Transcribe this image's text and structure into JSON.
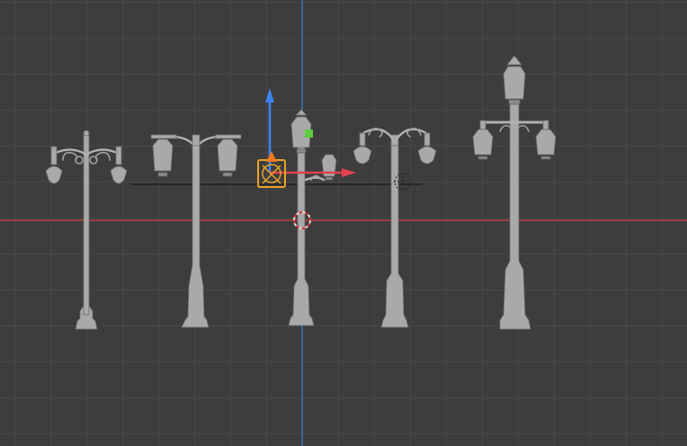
{
  "viewport": {
    "mode": "3d-viewport",
    "background_color": "#3d3d3d",
    "grid_color": "#474747",
    "axis_colors": {
      "x": "#bb4040",
      "z": "#3b6fc4"
    },
    "objects": [
      {
        "name": "lamp-post-1",
        "style": "double-globe-scroll"
      },
      {
        "name": "lamp-post-2",
        "style": "double-lantern-curved"
      },
      {
        "name": "lamp-post-3",
        "style": "single-lantern-selected"
      },
      {
        "name": "lamp-post-4",
        "style": "double-globe-scroll"
      },
      {
        "name": "lamp-post-5",
        "style": "triple-lantern"
      }
    ],
    "gizmo": {
      "x_arrow_color": "#e0404f",
      "z_arrow_color": "#3f82f0",
      "plane_handle_color": "#5fcc3f",
      "selection_color": "#e8a32a"
    }
  }
}
